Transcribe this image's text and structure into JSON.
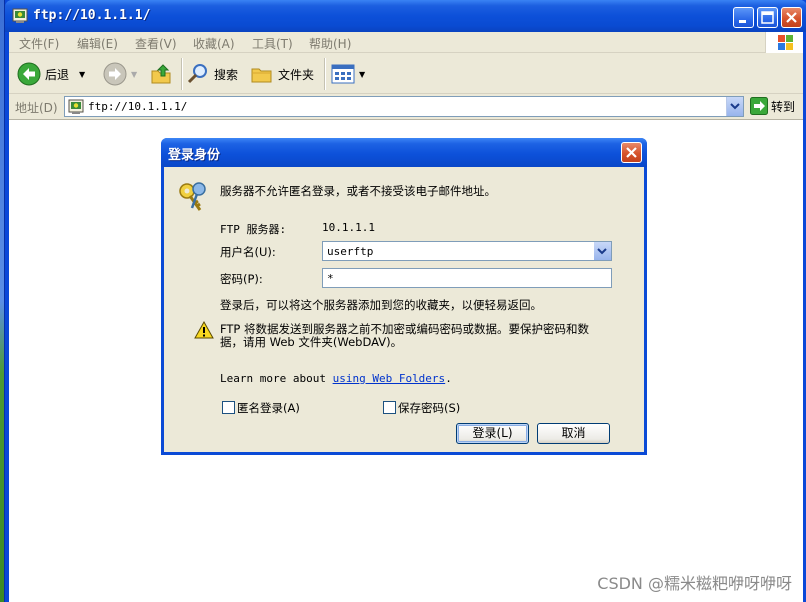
{
  "window": {
    "title": "ftp://10.1.1.1/"
  },
  "menu": [
    "文件(F)",
    "编辑(E)",
    "查看(V)",
    "收藏(A)",
    "工具(T)",
    "帮助(H)"
  ],
  "toolbar": {
    "back": "后退",
    "search": "搜索",
    "folders": "文件夹"
  },
  "address": {
    "label": "地址(D)",
    "value": "ftp://10.1.1.1/",
    "go": "转到"
  },
  "dialog": {
    "title": "登录身份",
    "message": "服务器不允许匿名登录，或者不接受该电子邮件地址。",
    "server_label": "FTP 服务器:",
    "server_value": "10.1.1.1",
    "username_label": "用户名(U):",
    "username_value": "userftp",
    "password_label": "密码(P):",
    "password_value": "*",
    "info": "登录后，可以将这个服务器添加到您的收藏夹，以便轻易返回。",
    "warning_line1": "FTP 将数据发送到服务器之前不加密或编码密码或数据。要保护密码和数",
    "warning_line2": "据，请用 Web 文件夹(WebDAV)。",
    "learn_prefix": "Learn more about",
    "learn_link": "using Web Folders",
    "learn_suffix": ".",
    "anon_label": "匿名登录(A)",
    "save_pwd_label": "保存密码(S)",
    "login_button": "登录(L)",
    "cancel_button": "取消"
  },
  "watermark": "CSDN @糯米糍粑咿呀咿呀",
  "colors": {
    "titlebar": "#0a4bd2",
    "chrome": "#ece9d8",
    "link": "#0033cc",
    "close": "#d6532c"
  }
}
